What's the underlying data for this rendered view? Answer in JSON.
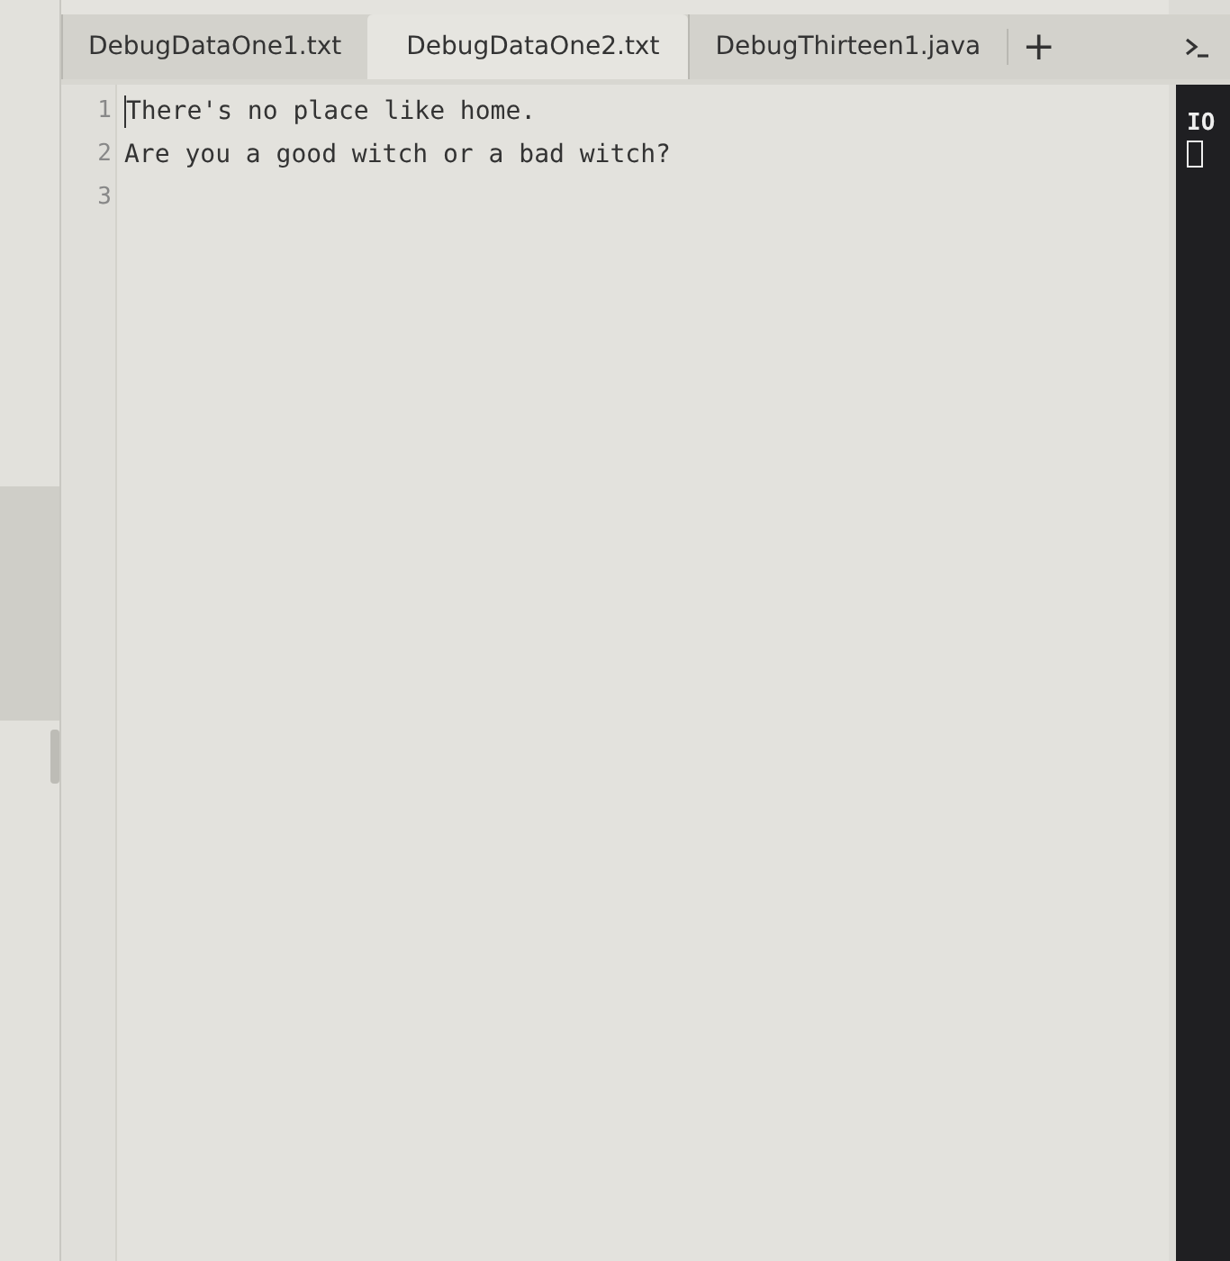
{
  "tabs": [
    {
      "label": "DebugDataOne1.txt",
      "selected": false
    },
    {
      "label": "DebugDataOne2.txt",
      "selected": true
    },
    {
      "label": "DebugThirteen1.java",
      "selected": false
    }
  ],
  "new_tab_button": "+",
  "editor": {
    "lines": [
      {
        "number": "1",
        "text": "There's no place like home.",
        "cursor": true
      },
      {
        "number": "2",
        "text": "Are you a good witch or a bad witch?",
        "cursor": false
      },
      {
        "number": "3",
        "cursor": false
      }
    ]
  },
  "io_panel": {
    "label": "IO"
  }
}
